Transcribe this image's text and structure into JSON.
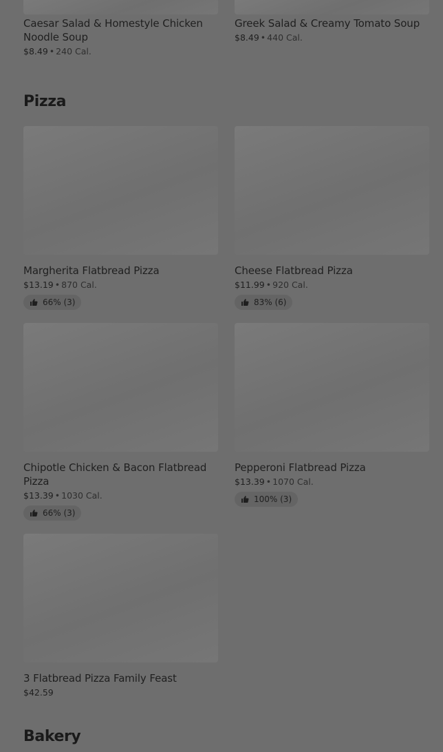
{
  "top_items": [
    {
      "name": "Caesar Salad & Homestyle Chicken Noodle Soup",
      "price": "$8.49",
      "cal": "240 Cal."
    },
    {
      "name": "Greek Salad & Creamy Tomato Soup",
      "price": "$8.49",
      "cal": "440 Cal."
    }
  ],
  "pizza": {
    "title": "Pizza",
    "items": [
      {
        "name": "Margherita Flatbread Pizza",
        "price": "$13.19",
        "cal": "870 Cal.",
        "rating": "66% (3)"
      },
      {
        "name": "Cheese Flatbread Pizza",
        "price": "$11.99",
        "cal": "920 Cal.",
        "rating": "83% (6)"
      },
      {
        "name": "Chipotle Chicken & Bacon Flatbread Pizza",
        "price": "$13.39",
        "cal": "1030 Cal.",
        "rating": "66% (3)"
      },
      {
        "name": "Pepperoni Flatbread Pizza",
        "price": "$13.39",
        "cal": "1070 Cal.",
        "rating": "100% (3)"
      },
      {
        "name": "3 Flatbread Pizza Family Feast",
        "price": "$42.59"
      }
    ]
  },
  "bakery": {
    "title": "Bakery"
  },
  "separator": "•",
  "icons": {
    "rating": "thumbs-up-icon"
  },
  "colors": {
    "overlay": "#6e6e6e",
    "text": "#1f1f1f"
  }
}
